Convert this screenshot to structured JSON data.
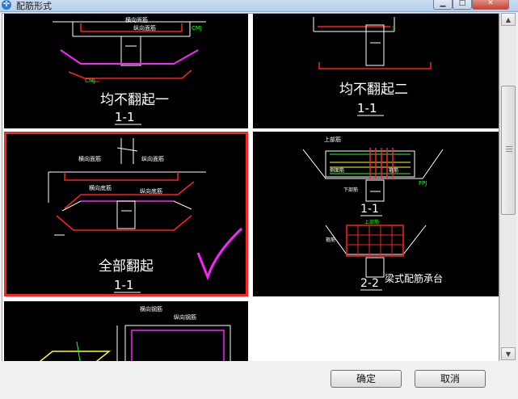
{
  "window": {
    "title": "配筋形式"
  },
  "cells": [
    {
      "caption": "均不翻起一",
      "section": "1-1"
    },
    {
      "caption": "均不翻起二",
      "section": "1-1"
    },
    {
      "caption": "全部翻起",
      "section": "1-1"
    },
    {
      "caption": "梁式配筋承台",
      "section_top": "1-1",
      "section_bottom": "2-2"
    },
    {
      "caption": "",
      "section": ""
    }
  ],
  "labels": {
    "c1_top": "横向面筋",
    "c1_top2": "纵向面筋",
    "c1_cmj": "CMJ",
    "c1_cmj2": "CMJ",
    "c3_hmj": "横向面筋",
    "c3_zmj": "纵向面筋",
    "c3_hdj": "横向底筋",
    "c3_zdj": "纵向底筋",
    "c4_sbj": "上部筋",
    "c4_ccj": "侧面筋",
    "c4_xbj": "下部筋",
    "c4_gj": "箍筋",
    "c4_fpj": "FPJ",
    "c4_gj2": "箍筋",
    "c4_sj": "上部筋",
    "c5_hgj": "横向钢筋",
    "c5_zgj": "纵向钢筋"
  },
  "footer": {
    "ok": "确定",
    "cancel": "取消"
  },
  "colors": {
    "line": "#ffffff",
    "rebar_red": "#ff2020",
    "rebar_magenta": "#ff20ff",
    "label_green": "#20ff20",
    "label_yellow": "#ffff20",
    "selected": "#ff2020"
  }
}
